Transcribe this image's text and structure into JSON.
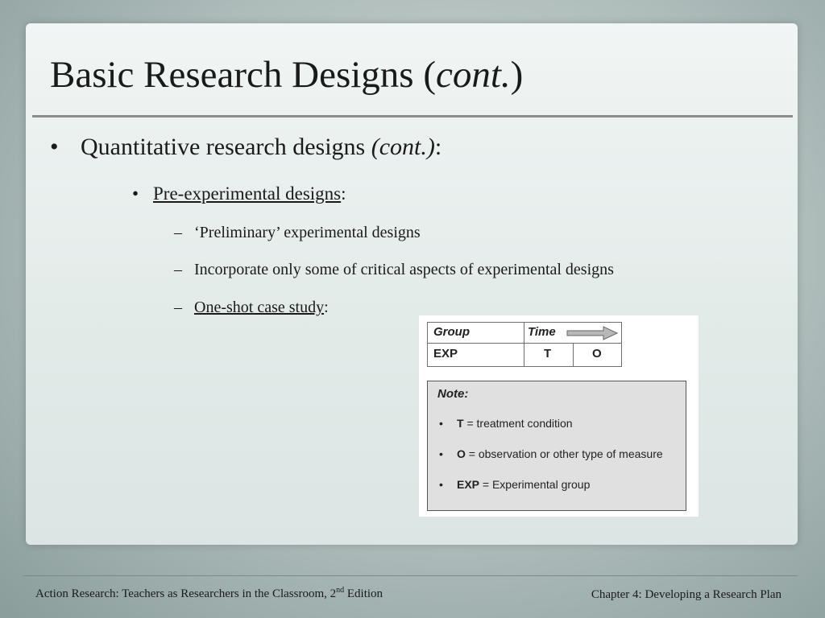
{
  "slide": {
    "title_main": "Basic Research Designs (",
    "title_italic": "cont.",
    "title_end": ")",
    "bullet1": {
      "marker": "•",
      "text": "Quantitative research designs ",
      "italic": "(cont.)",
      "suffix": ":"
    },
    "bullet2": {
      "marker": "•",
      "text": "Pre-experimental designs",
      "suffix": ":"
    },
    "sub_items": [
      {
        "marker": "–",
        "text": "‘Preliminary’ experimental designs"
      },
      {
        "marker": "–",
        "text": "Incorporate only some of critical aspects of experimental designs"
      },
      {
        "marker": "–",
        "text": "One-shot case study",
        "suffix": ":"
      }
    ]
  },
  "design_table": {
    "header_group": "Group",
    "header_time": "Time",
    "row_group": "EXP",
    "row_t": "T",
    "row_o": "O"
  },
  "note": {
    "title": "Note:",
    "items": [
      {
        "bullet": "•",
        "key": "T",
        "text": " = treatment condition"
      },
      {
        "bullet": "•",
        "key": "O",
        "text": " = observation or other type of measure"
      },
      {
        "bullet": "•",
        "key": "EXP",
        "text": " = Experimental group"
      }
    ]
  },
  "footer": {
    "left": "Action Research: Teachers as Researchers in the Classroom, 2",
    "left_sup": "nd",
    "left_end": " Edition",
    "right": "Chapter 4:  Developing a Research Plan"
  }
}
